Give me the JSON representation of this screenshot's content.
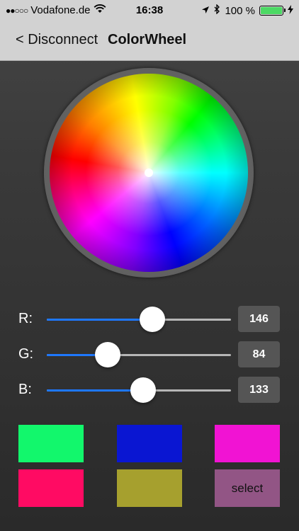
{
  "status_bar": {
    "signal_dots": "●●○○○",
    "carrier": "Vodafone.de",
    "time": "16:38",
    "battery_percent": "100 %",
    "icons": [
      "wifi-icon",
      "location-arrow-icon",
      "bluetooth-icon",
      "battery-icon",
      "charging-bolt-icon"
    ]
  },
  "nav": {
    "back_label": "< Disconnect",
    "title": "ColorWheel"
  },
  "wheel": {
    "colors": [
      "#00ffff",
      "#0000ff",
      "#ff00ff",
      "#ff0000",
      "#ffff00",
      "#00ff00"
    ]
  },
  "sliders": [
    {
      "label": "R:",
      "value": "146",
      "fraction": 0.573
    },
    {
      "label": "G:",
      "value": "84",
      "fraction": 0.33
    },
    {
      "label": "B:",
      "value": "133",
      "fraction": 0.522
    }
  ],
  "swatches": [
    {
      "color": "#12f76c",
      "label": ""
    },
    {
      "color": "#0a16d2",
      "label": ""
    },
    {
      "color": "#f113d3",
      "label": ""
    },
    {
      "color": "#ff0b63",
      "label": ""
    },
    {
      "color": "#a6a02e",
      "label": ""
    },
    {
      "color": "#925585",
      "label": "select"
    }
  ]
}
